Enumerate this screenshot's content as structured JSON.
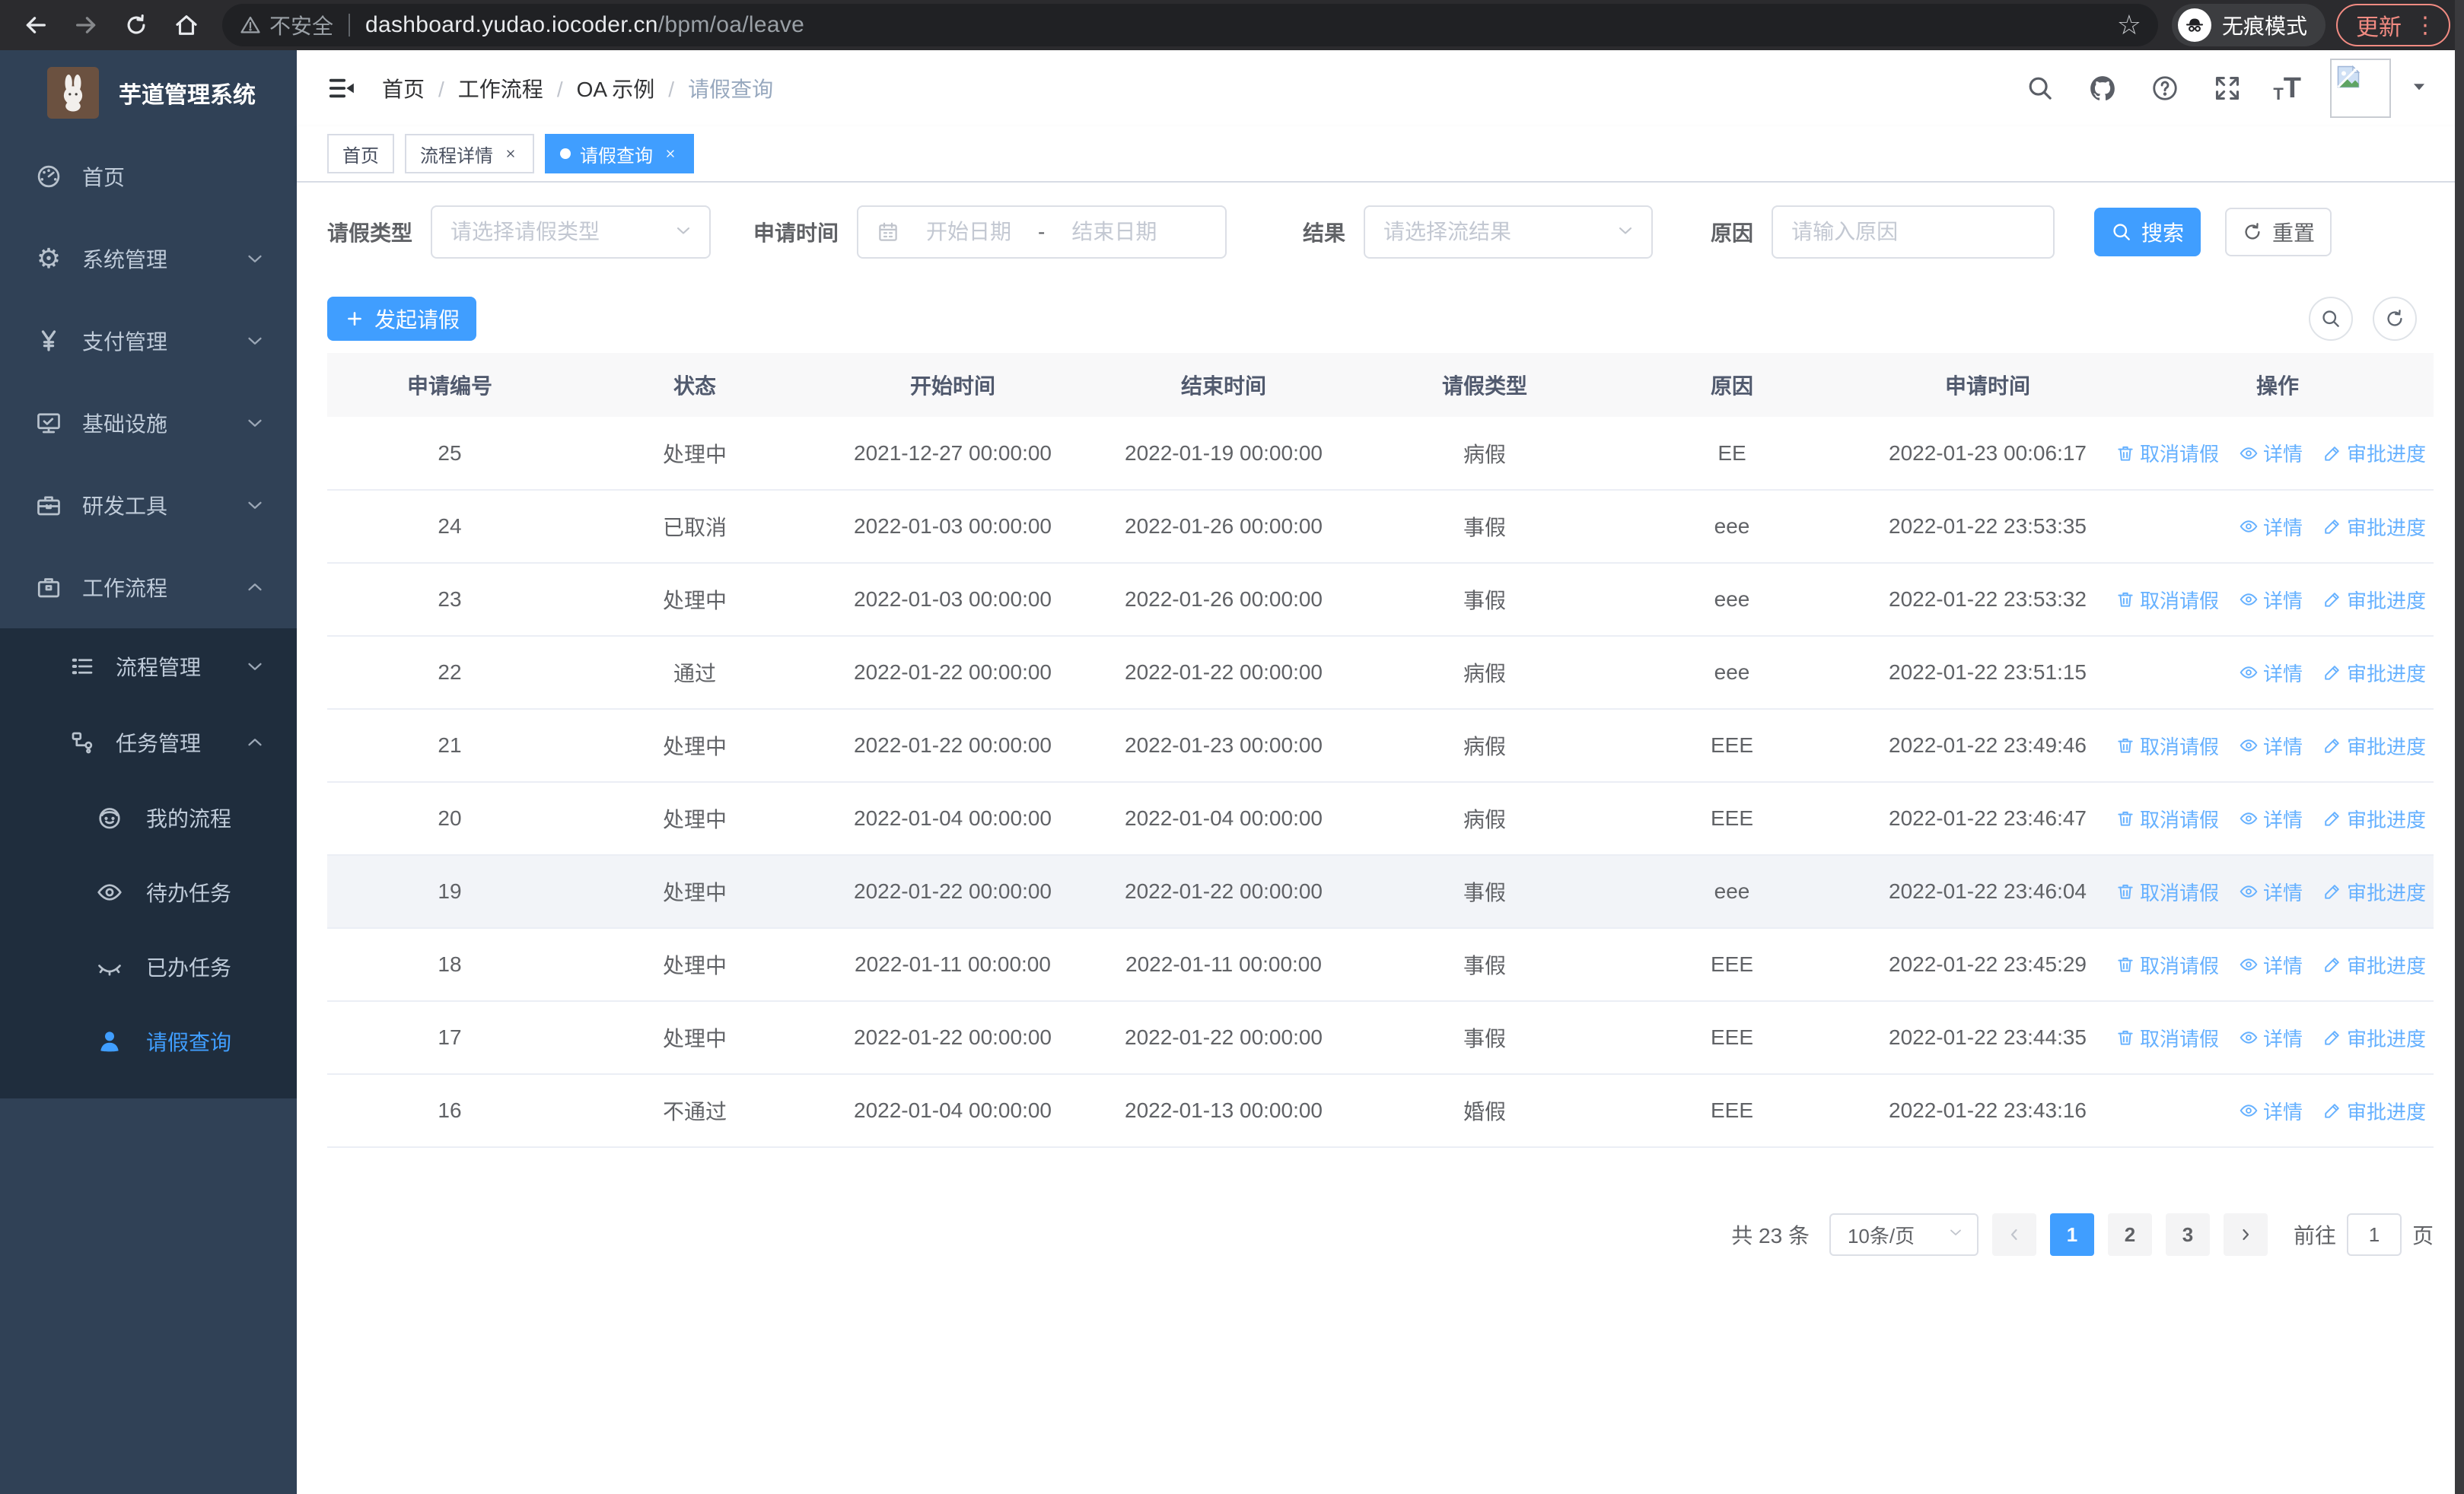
{
  "colors": {
    "accent": "#409EFF",
    "link": "#66b1ff",
    "sidebar_bg": "#304156",
    "sidebar_submenu_bg": "#1f2d3d",
    "update_pill": "#f28b82"
  },
  "browser": {
    "not_secure_label": "不安全",
    "url_host": "dashboard.yudao.iocoder.cn",
    "url_path": "/bpm/oa/leave",
    "incognito_label": "无痕模式",
    "update_label": "更新"
  },
  "sidebar": {
    "app_title": "芋道管理系统",
    "menu": [
      {
        "label": "首页",
        "icon": "dashboard-icon"
      },
      {
        "label": "系统管理",
        "icon": "gear-icon",
        "chevron": "down"
      },
      {
        "label": "支付管理",
        "icon": "yen-icon",
        "chevron": "down"
      },
      {
        "label": "基础设施",
        "icon": "monitor-icon",
        "chevron": "down"
      },
      {
        "label": "研发工具",
        "icon": "toolbox-icon",
        "chevron": "down"
      },
      {
        "label": "工作流程",
        "icon": "briefcase-icon",
        "chevron": "up"
      },
      {
        "label": "流程管理",
        "icon": "list-tree-icon",
        "chevron": "down"
      },
      {
        "label": "任务管理",
        "icon": "flow-icon",
        "chevron": "up"
      },
      {
        "label": "我的流程",
        "icon": "face-icon"
      },
      {
        "label": "待办任务",
        "icon": "eye-icon"
      },
      {
        "label": "已办任务",
        "icon": "eye-closed-icon"
      },
      {
        "label": "请假查询",
        "icon": "user-icon",
        "active": true
      }
    ]
  },
  "header": {
    "breadcrumb": [
      "首页",
      "工作流程",
      "OA 示例",
      "请假查询"
    ]
  },
  "tabs": [
    {
      "label": "首页"
    },
    {
      "label": "流程详情",
      "closable": true
    },
    {
      "label": "请假查询",
      "closable": true,
      "active": true
    }
  ],
  "filters": {
    "leave_type_label": "请假类型",
    "leave_type_placeholder": "请选择请假类型",
    "apply_time_label": "申请时间",
    "date_start_placeholder": "开始日期",
    "date_separator": "-",
    "date_end_placeholder": "结束日期",
    "result_label": "结果",
    "result_placeholder": "请选择流结果",
    "reason_label": "原因",
    "reason_placeholder": "请输入原因",
    "search_label": "搜索",
    "reset_label": "重置"
  },
  "toolbar": {
    "create_label": "发起请假"
  },
  "table": {
    "columns": [
      "申请编号",
      "状态",
      "开始时间",
      "结束时间",
      "请假类型",
      "原因",
      "申请时间",
      "操作"
    ],
    "action_labels": {
      "cancel": "取消请假",
      "detail": "详情",
      "progress": "审批进度"
    },
    "rows": [
      {
        "id": "25",
        "status": "处理中",
        "start": "2021-12-27 00:00:00",
        "end": "2022-01-19 00:00:00",
        "type": "病假",
        "reason": "EE",
        "apply_time": "2022-01-23 00:06:17",
        "actions": [
          "cancel",
          "detail",
          "progress"
        ]
      },
      {
        "id": "24",
        "status": "已取消",
        "start": "2022-01-03 00:00:00",
        "end": "2022-01-26 00:00:00",
        "type": "事假",
        "reason": "eee",
        "apply_time": "2022-01-22 23:53:35",
        "actions": [
          "detail",
          "progress"
        ]
      },
      {
        "id": "23",
        "status": "处理中",
        "start": "2022-01-03 00:00:00",
        "end": "2022-01-26 00:00:00",
        "type": "事假",
        "reason": "eee",
        "apply_time": "2022-01-22 23:53:32",
        "actions": [
          "cancel",
          "detail",
          "progress"
        ]
      },
      {
        "id": "22",
        "status": "通过",
        "start": "2022-01-22 00:00:00",
        "end": "2022-01-22 00:00:00",
        "type": "病假",
        "reason": "eee",
        "apply_time": "2022-01-22 23:51:15",
        "actions": [
          "detail",
          "progress"
        ]
      },
      {
        "id": "21",
        "status": "处理中",
        "start": "2022-01-22 00:00:00",
        "end": "2022-01-23 00:00:00",
        "type": "病假",
        "reason": "EEE",
        "apply_time": "2022-01-22 23:49:46",
        "actions": [
          "cancel",
          "detail",
          "progress"
        ]
      },
      {
        "id": "20",
        "status": "处理中",
        "start": "2022-01-04 00:00:00",
        "end": "2022-01-04 00:00:00",
        "type": "病假",
        "reason": "EEE",
        "apply_time": "2022-01-22 23:46:47",
        "actions": [
          "cancel",
          "detail",
          "progress"
        ]
      },
      {
        "id": "19",
        "status": "处理中",
        "start": "2022-01-22 00:00:00",
        "end": "2022-01-22 00:00:00",
        "type": "事假",
        "reason": "eee",
        "apply_time": "2022-01-22 23:46:04",
        "actions": [
          "cancel",
          "detail",
          "progress"
        ],
        "highlight": true
      },
      {
        "id": "18",
        "status": "处理中",
        "start": "2022-01-11 00:00:00",
        "end": "2022-01-11 00:00:00",
        "type": "事假",
        "reason": "EEE",
        "apply_time": "2022-01-22 23:45:29",
        "actions": [
          "cancel",
          "detail",
          "progress"
        ]
      },
      {
        "id": "17",
        "status": "处理中",
        "start": "2022-01-22 00:00:00",
        "end": "2022-01-22 00:00:00",
        "type": "事假",
        "reason": "EEE",
        "apply_time": "2022-01-22 23:44:35",
        "actions": [
          "cancel",
          "detail",
          "progress"
        ]
      },
      {
        "id": "16",
        "status": "不通过",
        "start": "2022-01-04 00:00:00",
        "end": "2022-01-13 00:00:00",
        "type": "婚假",
        "reason": "EEE",
        "apply_time": "2022-01-22 23:43:16",
        "actions": [
          "detail",
          "progress"
        ]
      }
    ]
  },
  "pagination": {
    "total_text": "共 23 条",
    "page_size": "10条/页",
    "pages": [
      "1",
      "2",
      "3"
    ],
    "active_page": "1",
    "goto_label": "前往",
    "goto_value": "1",
    "page_unit": "页"
  }
}
